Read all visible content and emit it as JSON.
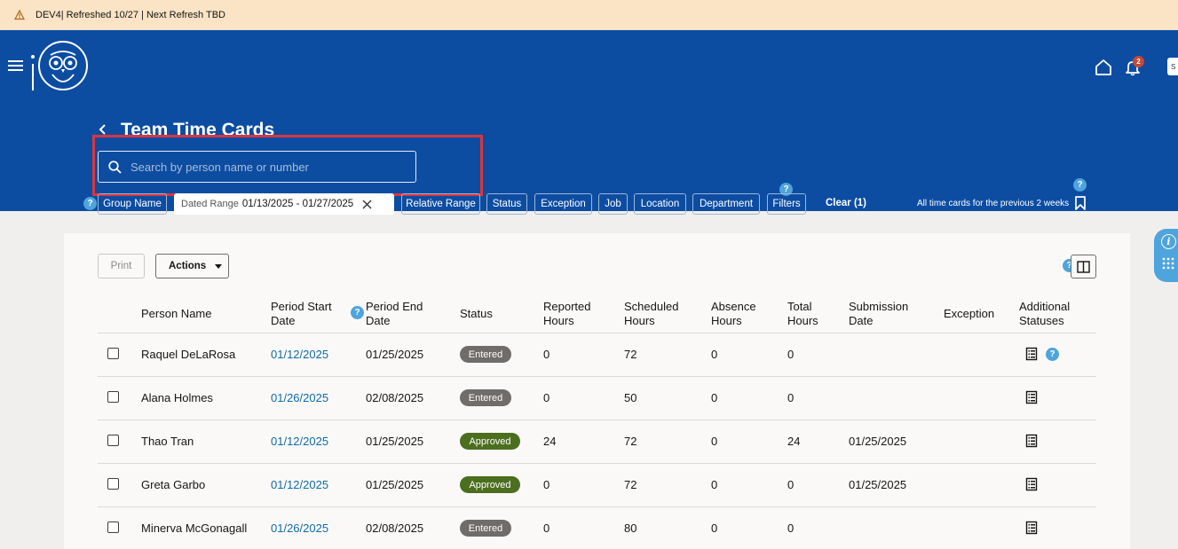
{
  "banner": {
    "text": "DEV4| Refreshed 10/27 | Next Refresh TBD",
    "icon": "warning-icon"
  },
  "header": {
    "title": "Team Time Cards",
    "user_initials": "S",
    "notification_count": "2"
  },
  "search": {
    "placeholder": "Search by person name or number"
  },
  "filters": {
    "group_name": "Group Name",
    "dated_range_label": "Dated Range",
    "dated_range_value": "01/13/2025 - 01/27/2025",
    "relative_range": "Relative Range",
    "status": "Status",
    "exception": "Exception",
    "job": "Job",
    "location": "Location",
    "department": "Department",
    "filters": "Filters",
    "clear": "Clear (1)",
    "saved_search": "All time cards for the previous 2 weeks"
  },
  "help_mark": "?",
  "toolbar": {
    "print": "Print",
    "actions": "Actions"
  },
  "table": {
    "headers": {
      "person_name": "Person Name",
      "period_start_1": "Period Start",
      "period_start_2": "Date",
      "period_end_1": "Period End",
      "period_end_2": "Date",
      "status": "Status",
      "reported_1": "Reported",
      "reported_2": "Hours",
      "scheduled_1": "Scheduled",
      "scheduled_2": "Hours",
      "absence_1": "Absence",
      "absence_2": "Hours",
      "total_1": "Total",
      "total_2": "Hours",
      "submission_1": "Submission",
      "submission_2": "Date",
      "exception": "Exception",
      "additional_1": "Additional",
      "additional_2": "Statuses"
    },
    "rows": [
      {
        "name": "Raquel DeLaRosa",
        "start": "01/12/2025",
        "end": "01/25/2025",
        "status": "Entered",
        "reported": "0",
        "scheduled": "72",
        "absence": "0",
        "total": "0",
        "submission": "",
        "exception": ""
      },
      {
        "name": "Alana Holmes",
        "start": "01/26/2025",
        "end": "02/08/2025",
        "status": "Entered",
        "reported": "0",
        "scheduled": "50",
        "absence": "0",
        "total": "0",
        "submission": "",
        "exception": ""
      },
      {
        "name": "Thao Tran",
        "start": "01/12/2025",
        "end": "01/25/2025",
        "status": "Approved",
        "reported": "24",
        "scheduled": "72",
        "absence": "0",
        "total": "24",
        "submission": "01/25/2025",
        "exception": ""
      },
      {
        "name": "Greta Garbo",
        "start": "01/12/2025",
        "end": "01/25/2025",
        "status": "Approved",
        "reported": "0",
        "scheduled": "72",
        "absence": "0",
        "total": "0",
        "submission": "01/25/2025",
        "exception": ""
      },
      {
        "name": "Minerva McGonagall",
        "start": "01/26/2025",
        "end": "02/08/2025",
        "status": "Entered",
        "reported": "0",
        "scheduled": "80",
        "absence": "0",
        "total": "0",
        "submission": "",
        "exception": ""
      }
    ]
  },
  "colors": {
    "header_blue": "#0c4da2",
    "banner": "#fbe3c6",
    "entered": "#6f6c69",
    "approved": "#4c6e1f",
    "link": "#0e6aa8",
    "highlight": "#d9363e",
    "help": "#4ea4dc"
  }
}
